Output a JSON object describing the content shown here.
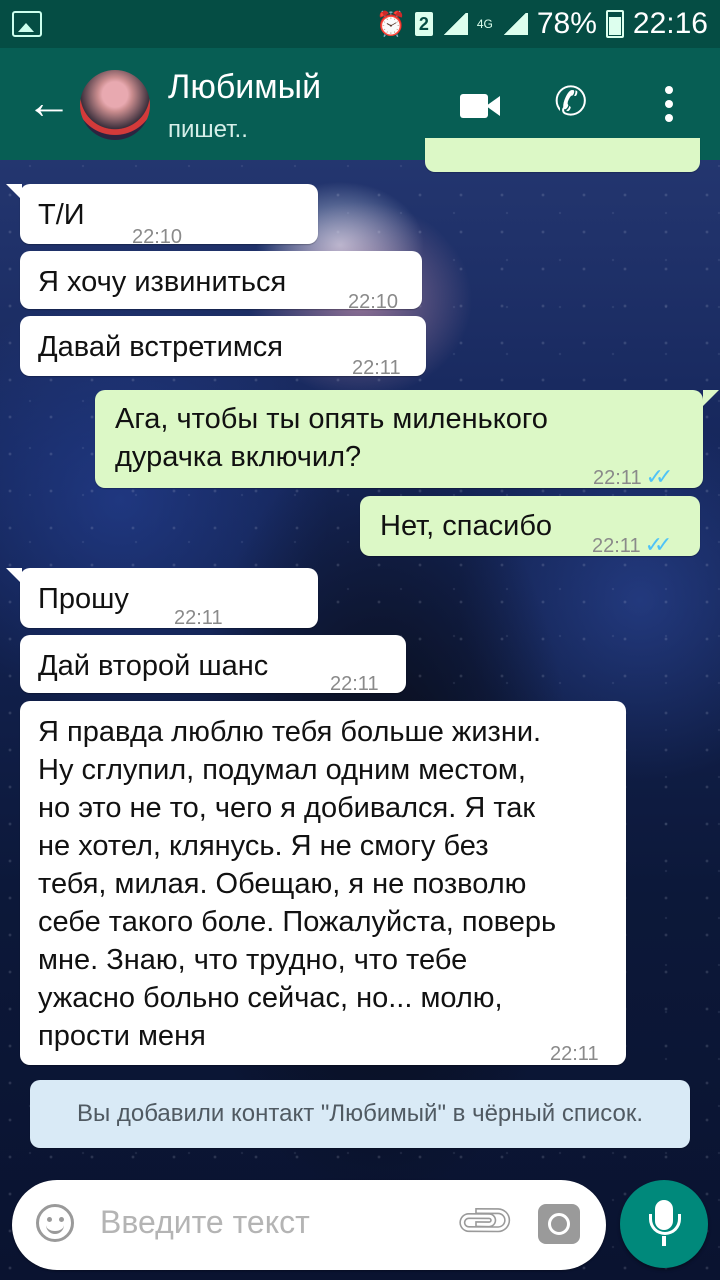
{
  "statusbar": {
    "sim_badge": "2",
    "network": "4G",
    "battery": "78%",
    "time": "22:16"
  },
  "header": {
    "contact_name": "Любимый",
    "contact_status": "пишет..",
    "icons": [
      "back-arrow-icon",
      "video-call-icon",
      "phone-icon",
      "more-vert-icon"
    ]
  },
  "messages": [
    {
      "dir": "in",
      "text": "Т/И",
      "time": "22:10"
    },
    {
      "dir": "in",
      "text": "Я хочу извиниться",
      "time": "22:10"
    },
    {
      "dir": "in",
      "text": "Давай встретимся",
      "time": "22:11"
    },
    {
      "dir": "out",
      "text_line1": "Ага, чтобы ты опять миленького",
      "text_line2": "дурачка включил?",
      "time": "22:11",
      "status": "read"
    },
    {
      "dir": "out",
      "text": "Нет, спасибо",
      "time": "22:11",
      "status": "read"
    },
    {
      "dir": "in",
      "text": "Прошу",
      "time": "22:11"
    },
    {
      "dir": "in",
      "text": "Дай второй шанс",
      "time": "22:11"
    },
    {
      "dir": "in",
      "lines": [
        "Я правда люблю тебя больше жизни.",
        "Ну сглупил, подумал одним местом,",
        "но это не то, чего я добивался. Я так",
        "не хотел, клянусь. Я не смогу без",
        "тебя, милая. Обещаю, я не позволю",
        "себе такого боле. Пожалуйста, поверь",
        "мне. Знаю, что трудно, что тебе",
        "ужасно больно сейчас, но... молю,",
        "прости меня"
      ],
      "time": "22:11"
    }
  ],
  "system_message": "Вы добавили контакт \"Любимый\" в чёрный список.",
  "composer": {
    "placeholder": "Введите текст"
  },
  "colors": {
    "header": "#075e54",
    "statusbar": "#054d44",
    "outgoing_bubble": "#dcf8c6",
    "incoming_bubble": "#ffffff",
    "read_ticks": "#4fc3f7",
    "mic_button": "#00897b"
  }
}
